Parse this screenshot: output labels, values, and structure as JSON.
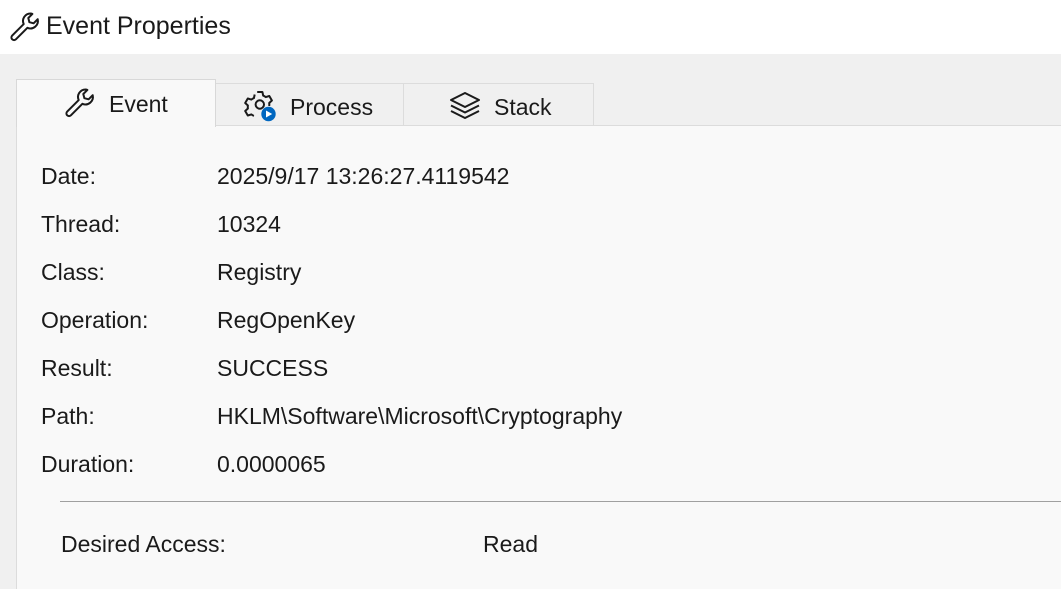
{
  "window": {
    "title": "Event Properties",
    "icon": "wrench-icon"
  },
  "tabs": [
    {
      "label": "Event",
      "icon": "wrench-icon",
      "selected": true
    },
    {
      "label": "Process",
      "icon": "gear-play-icon",
      "selected": false
    },
    {
      "label": "Stack",
      "icon": "layers-icon",
      "selected": false
    }
  ],
  "properties": [
    {
      "label": "Date:",
      "value": "2025/9/17 13:26:27.4119542"
    },
    {
      "label": "Thread:",
      "value": "10324"
    },
    {
      "label": "Class:",
      "value": "Registry"
    },
    {
      "label": "Operation:",
      "value": "RegOpenKey"
    },
    {
      "label": "Result:",
      "value": "SUCCESS"
    },
    {
      "label": "Path:",
      "value": "HKLM\\Software\\Microsoft\\Cryptography"
    },
    {
      "label": "Duration:",
      "value": "0.0000065"
    }
  ],
  "details": [
    {
      "label": "Desired Access:",
      "value": "Read"
    }
  ],
  "colors": {
    "accent": "#0067c0",
    "panel_background": "#f9f9f9",
    "window_background": "#f0f0f0",
    "titlebar_background": "#ffffff",
    "text": "#1a1a1a"
  }
}
